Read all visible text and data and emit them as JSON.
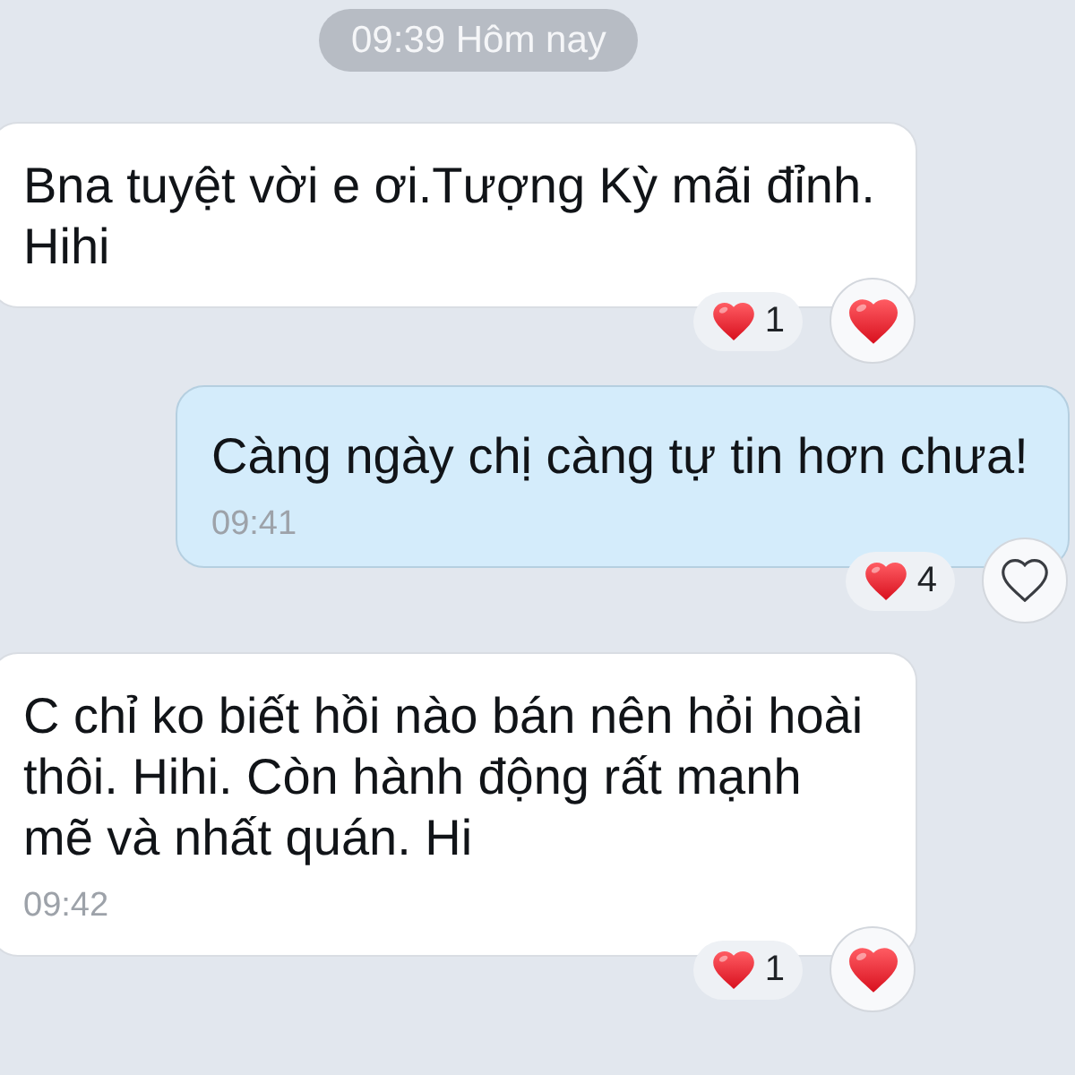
{
  "date_separator": {
    "text": "09:39 Hôm nay"
  },
  "messages": [
    {
      "kind": "incoming",
      "lines": [
        "Bna tuyệt vời e ơi.Tượng Kỳ mãi đỉnh.",
        "Hihi"
      ],
      "reaction_count": "1",
      "react_button": {
        "selected": true
      }
    },
    {
      "kind": "outgoing",
      "lines": [
        "Càng ngày chị càng tự tin hơn chưa!"
      ],
      "time": "09:41",
      "reaction_count": "4",
      "react_button": {
        "selected": false
      }
    },
    {
      "kind": "incoming",
      "lines": [
        "C chỉ ko biết hồi nào bán nên hỏi hoài",
        "thôi. Hihi. Còn hành động rất mạnh",
        "mẽ và nhất quán. Hi"
      ],
      "time": "09:42",
      "reaction_count": "1",
      "react_button": {
        "selected": true
      }
    }
  ]
}
